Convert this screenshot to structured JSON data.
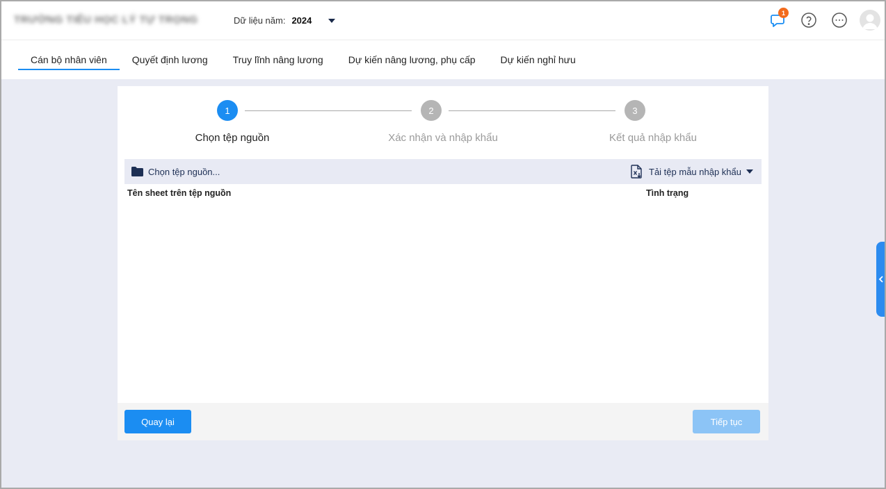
{
  "header": {
    "org_name": "TRƯỜNG TIỂU HỌC LÝ TỰ TRỌNG",
    "year_label": "Dữ liệu năm:",
    "year_value": "2024",
    "notification_count": "1",
    "icons": [
      "chat-icon",
      "help-icon",
      "more-icon",
      "avatar-icon"
    ]
  },
  "tabs": [
    {
      "label": "Cán bộ nhân viên",
      "active": true
    },
    {
      "label": "Quyết định lương"
    },
    {
      "label": "Truy lĩnh nâng lương"
    },
    {
      "label": "Dự kiến nâng lương, phụ cấp"
    },
    {
      "label": "Dự kiến nghỉ hưu"
    }
  ],
  "stepper": {
    "steps": [
      {
        "number": "1",
        "label": "Chọn tệp nguồn",
        "state": "active"
      },
      {
        "number": "2",
        "label": "Xác nhận và nhập khẩu",
        "state": "pending"
      },
      {
        "number": "3",
        "label": "Kết quả nhập khẩu",
        "state": "pending"
      }
    ]
  },
  "toolbar": {
    "choose_file": "Chọn tệp nguồn...",
    "download_template": "Tải tệp mẫu nhập khẩu"
  },
  "table": {
    "columns": [
      "Tên sheet trên tệp nguồn",
      "Tình trạng"
    ]
  },
  "footer": {
    "back_label": "Quay lại",
    "next_label": "Tiếp tục"
  },
  "colors": {
    "primary": "#1b8df2",
    "primary_disabled": "#8cc4f6",
    "badge": "#f26b1d",
    "step_inactive": "#b5b5b5"
  }
}
